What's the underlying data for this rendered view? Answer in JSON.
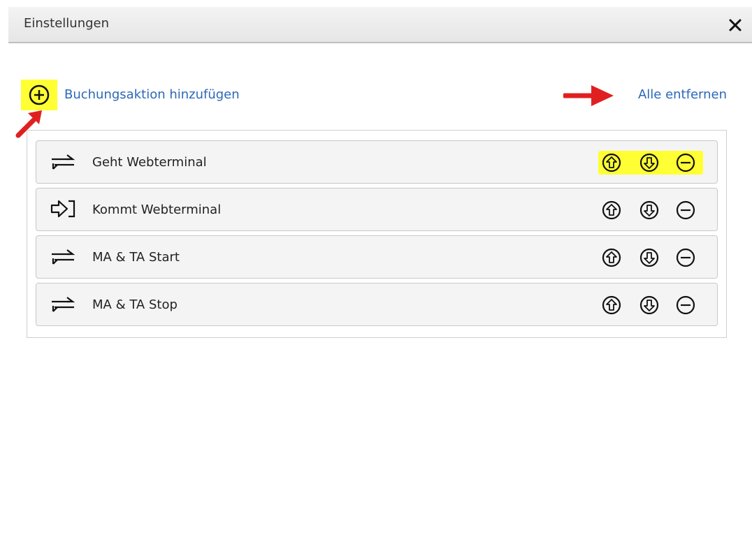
{
  "window": {
    "title": "Einstellungen",
    "close_icon": "close-icon"
  },
  "toolbar": {
    "add_label": "Buchungsaktion hinzufügen",
    "add_icon": "plus-circle-icon",
    "remove_all_label": "Alle entfernen"
  },
  "colors": {
    "link": "#2b68b7",
    "highlight": "#ffff33",
    "annotation_arrow": "#e02020"
  },
  "items": [
    {
      "label": "Geht Webterminal",
      "icon": "transfer-arrows-icon",
      "actions_highlighted": true
    },
    {
      "label": "Kommt Webterminal",
      "icon": "login-icon",
      "actions_highlighted": false
    },
    {
      "label": "MA & TA Start",
      "icon": "transfer-arrows-icon",
      "actions_highlighted": false
    },
    {
      "label": "MA & TA Stop",
      "icon": "transfer-arrows-icon",
      "actions_highlighted": false
    }
  ]
}
